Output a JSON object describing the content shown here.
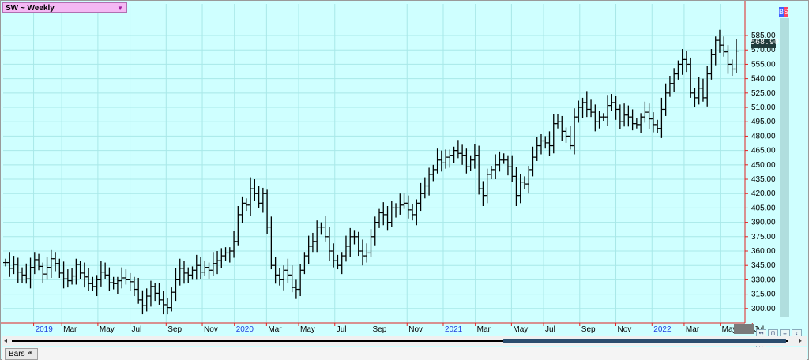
{
  "symbol_label": "SW ~ Weekly",
  "last_price": "568.90",
  "badge_letters": [
    "B",
    "S"
  ],
  "colors": {
    "background": "#cfffff",
    "grid": "#a8e8e8",
    "bars": "#000000",
    "axis_line": "#e02020",
    "badge_b": "#4060ff",
    "badge_s": "#ff4060"
  },
  "footer": {
    "tab_label": "Bars",
    "nav_left": "◂",
    "nav_right": "▸"
  },
  "corner_buttons": [
    "linear-icon",
    "zoom-icon",
    "fit-icon",
    "scale-icon",
    "sync-icon"
  ],
  "chart_data": {
    "type": "ohlc",
    "title": "SW ~ Weekly",
    "y_range": [
      285,
      618
    ],
    "y_ticks": [
      "300.00",
      "315.00",
      "330.00",
      "345.00",
      "360.00",
      "375.00",
      "390.00",
      "405.00",
      "420.00",
      "435.00",
      "450.00",
      "465.00",
      "480.00",
      "495.00",
      "510.00",
      "525.00",
      "540.00",
      "555.00",
      "570.00",
      "585.00"
    ],
    "x_range": [
      0,
      182
    ],
    "x_labels": [
      {
        "label": "2019",
        "week": 7,
        "year": true
      },
      {
        "label": "Mar",
        "week": 14,
        "year": false
      },
      {
        "label": "May",
        "week": 23,
        "year": false
      },
      {
        "label": "Jul",
        "week": 31,
        "year": false
      },
      {
        "label": "Sep",
        "week": 40,
        "year": false
      },
      {
        "label": "Nov",
        "week": 49,
        "year": false
      },
      {
        "label": "2020",
        "week": 57,
        "year": true
      },
      {
        "label": "Mar",
        "week": 65,
        "year": false
      },
      {
        "label": "May",
        "week": 73,
        "year": false
      },
      {
        "label": "Jul",
        "week": 82,
        "year": false
      },
      {
        "label": "Sep",
        "week": 91,
        "year": false
      },
      {
        "label": "Nov",
        "week": 100,
        "year": false
      },
      {
        "label": "2021",
        "week": 109,
        "year": true
      },
      {
        "label": "Mar",
        "week": 117,
        "year": false
      },
      {
        "label": "May",
        "week": 126,
        "year": false
      },
      {
        "label": "Jul",
        "week": 134,
        "year": false
      },
      {
        "label": "Sep",
        "week": 143,
        "year": false
      },
      {
        "label": "Nov",
        "week": 152,
        "year": false
      },
      {
        "label": "2022",
        "week": 161,
        "year": true
      },
      {
        "label": "Mar",
        "week": 169,
        "year": false
      },
      {
        "label": "May",
        "week": 178,
        "year": false
      },
      {
        "label": "Jul",
        "week": 186,
        "year": false
      }
    ],
    "grid": true,
    "closes": [
      348,
      342,
      346,
      338,
      335,
      331,
      343,
      351,
      344,
      336,
      343,
      352,
      347,
      337,
      331,
      329,
      334,
      346,
      337,
      333,
      326,
      323,
      330,
      338,
      335,
      327,
      326,
      329,
      332,
      330,
      328,
      320,
      309,
      303,
      313,
      323,
      316,
      309,
      304,
      301,
      317,
      330,
      342,
      337,
      335,
      340,
      345,
      338,
      343,
      340,
      347,
      350,
      355,
      358,
      360,
      370,
      398,
      410,
      408,
      425,
      420,
      410,
      420,
      385,
      345,
      335,
      330,
      340,
      335,
      322,
      320,
      340,
      355,
      365,
      370,
      385,
      385,
      375,
      360,
      350,
      345,
      355,
      365,
      375,
      375,
      360,
      355,
      358,
      375,
      390,
      400,
      398,
      390,
      405,
      405,
      408,
      410,
      403,
      398,
      410,
      420,
      428,
      440,
      445,
      455,
      452,
      458,
      460,
      465,
      462,
      460,
      448,
      455,
      460,
      425,
      418,
      440,
      445,
      450,
      455,
      455,
      448,
      438,
      418,
      432,
      430,
      445,
      458,
      470,
      475,
      473,
      470,
      493,
      495,
      485,
      480,
      470,
      500,
      510,
      515,
      508,
      505,
      495,
      500,
      500,
      512,
      515,
      508,
      495,
      502,
      500,
      493,
      492,
      500,
      505,
      498,
      492,
      488,
      508,
      525,
      535,
      545,
      555,
      560,
      555,
      525,
      520,
      530,
      520,
      545,
      565,
      580,
      575,
      568,
      555,
      550,
      568.9
    ]
  }
}
